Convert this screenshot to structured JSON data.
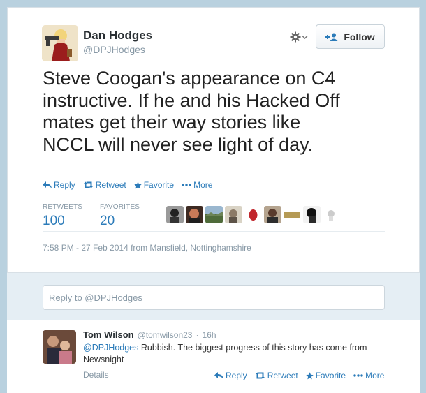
{
  "tweet": {
    "author_name": "Dan Hodges",
    "author_handle": "@DPJHodges",
    "follow_label": "Follow",
    "text": "Steve Coogan's appearance on C4\ninstructive. If he and his Hacked Off\nmates get their way stories like\nNCCL will never see light of day.",
    "actions": {
      "reply": "Reply",
      "retweet": "Retweet",
      "favorite": "Favorite",
      "more": "More"
    },
    "stats": {
      "retweets_label": "RETWEETS",
      "retweets_value": "100",
      "favorites_label": "FAVORITES",
      "favorites_value": "20"
    },
    "timestamp": "7:58 PM - 27 Feb 2014 from Mansfield, Nottinghamshire"
  },
  "reply_box": {
    "placeholder": "Reply to @DPJHodges"
  },
  "reply": {
    "author_name": "Tom Wilson",
    "author_handle": "@tomwilson23",
    "separator": "·",
    "time": "16h",
    "mention": "@DPJHodges",
    "text": " Rubbish. The biggest progress of this story has come from Newsnight",
    "details_label": "Details",
    "actions": {
      "reply": "Reply",
      "retweet": "Retweet",
      "favorite": "Favorite",
      "more": "More"
    }
  },
  "icons": {
    "gear": "gear-icon",
    "caret": "caret-down-icon",
    "follow": "add-user-icon",
    "reply": "reply-icon",
    "retweet": "retweet-icon",
    "favorite": "star-icon",
    "more": "more-dots-icon"
  },
  "colors": {
    "link": "#2b7bb9",
    "muted": "#8899a6",
    "page_background": "#b9d1df",
    "reply_section": "#e5eef4"
  }
}
